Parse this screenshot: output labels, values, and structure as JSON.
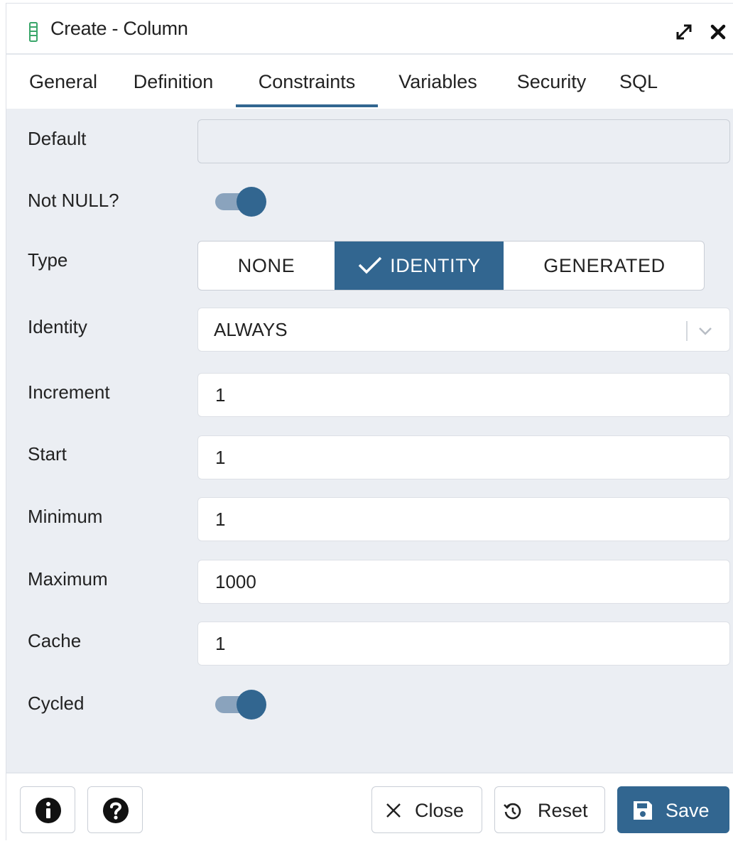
{
  "window": {
    "title": "Create - Column",
    "icon": "column-icon",
    "maximize_icon": "expand-icon",
    "close_icon": "close-icon"
  },
  "tabs": [
    {
      "label": "General",
      "active": false
    },
    {
      "label": "Definition",
      "active": false
    },
    {
      "label": "Constraints",
      "active": true
    },
    {
      "label": "Variables",
      "active": false
    },
    {
      "label": "Security",
      "active": false
    },
    {
      "label": "SQL",
      "active": false
    }
  ],
  "form": {
    "default": {
      "label": "Default",
      "value": "",
      "disabled": true
    },
    "not_null": {
      "label": "Not NULL?",
      "on": true
    },
    "type": {
      "label": "Type",
      "options": [
        "NONE",
        "IDENTITY",
        "GENERATED"
      ],
      "selected": "IDENTITY"
    },
    "identity": {
      "label": "Identity",
      "value": "ALWAYS"
    },
    "increment": {
      "label": "Increment",
      "value": "1"
    },
    "start": {
      "label": "Start",
      "value": "1"
    },
    "minimum": {
      "label": "Minimum",
      "value": "1"
    },
    "maximum": {
      "label": "Maximum",
      "value": "1000"
    },
    "cache": {
      "label": "Cache",
      "value": "1"
    },
    "cycled": {
      "label": "Cycled",
      "on": true
    }
  },
  "footer": {
    "info_icon": "info-icon",
    "help_icon": "help-icon",
    "close_label": "Close",
    "reset_label": "Reset",
    "save_label": "Save"
  },
  "colors": {
    "accent": "#326690",
    "toggle_track": "#8aa3bd",
    "panel_bg": "#ebeef3"
  }
}
